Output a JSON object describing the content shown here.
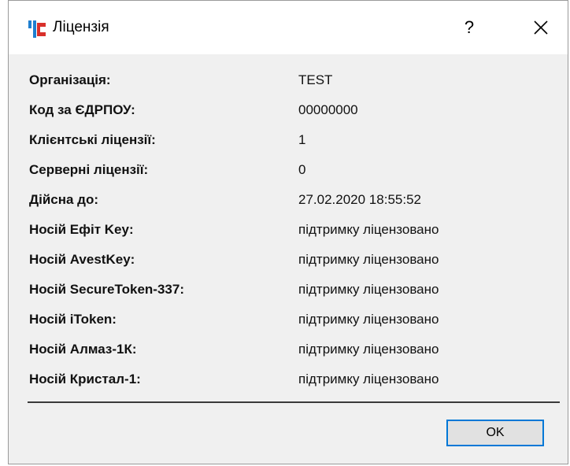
{
  "window": {
    "title": "Ліцензія",
    "help_glyph": "?",
    "ok_label": "OK",
    "icon": "app-logo-icon"
  },
  "license_rows": [
    {
      "label": "Організація:",
      "value": "TEST"
    },
    {
      "label": "Код за ЄДРПОУ:",
      "value": "00000000"
    },
    {
      "label": "Клієнтські ліцензії:",
      "value": "1"
    },
    {
      "label": "Серверні ліцензії:",
      "value": "0"
    },
    {
      "label": "Дійсна до:",
      "value": "27.02.2020 18:55:52"
    },
    {
      "label": "Носій Ефіт Key:",
      "value": "підтримку ліцензовано"
    },
    {
      "label": "Носій AvestKey:",
      "value": "підтримку ліцензовано"
    },
    {
      "label": "Носій SecureToken-337:",
      "value": "підтримку ліцензовано"
    },
    {
      "label": "Носій iToken:",
      "value": "підтримку ліцензовано"
    },
    {
      "label": "Носій Алмаз-1К:",
      "value": "підтримку ліцензовано"
    },
    {
      "label": "Носій Кристал-1:",
      "value": "підтримку ліцензовано"
    }
  ],
  "colors": {
    "logo_blue": "#1e7fd0",
    "logo_red": "#d9302b",
    "accent": "#0078d7"
  }
}
